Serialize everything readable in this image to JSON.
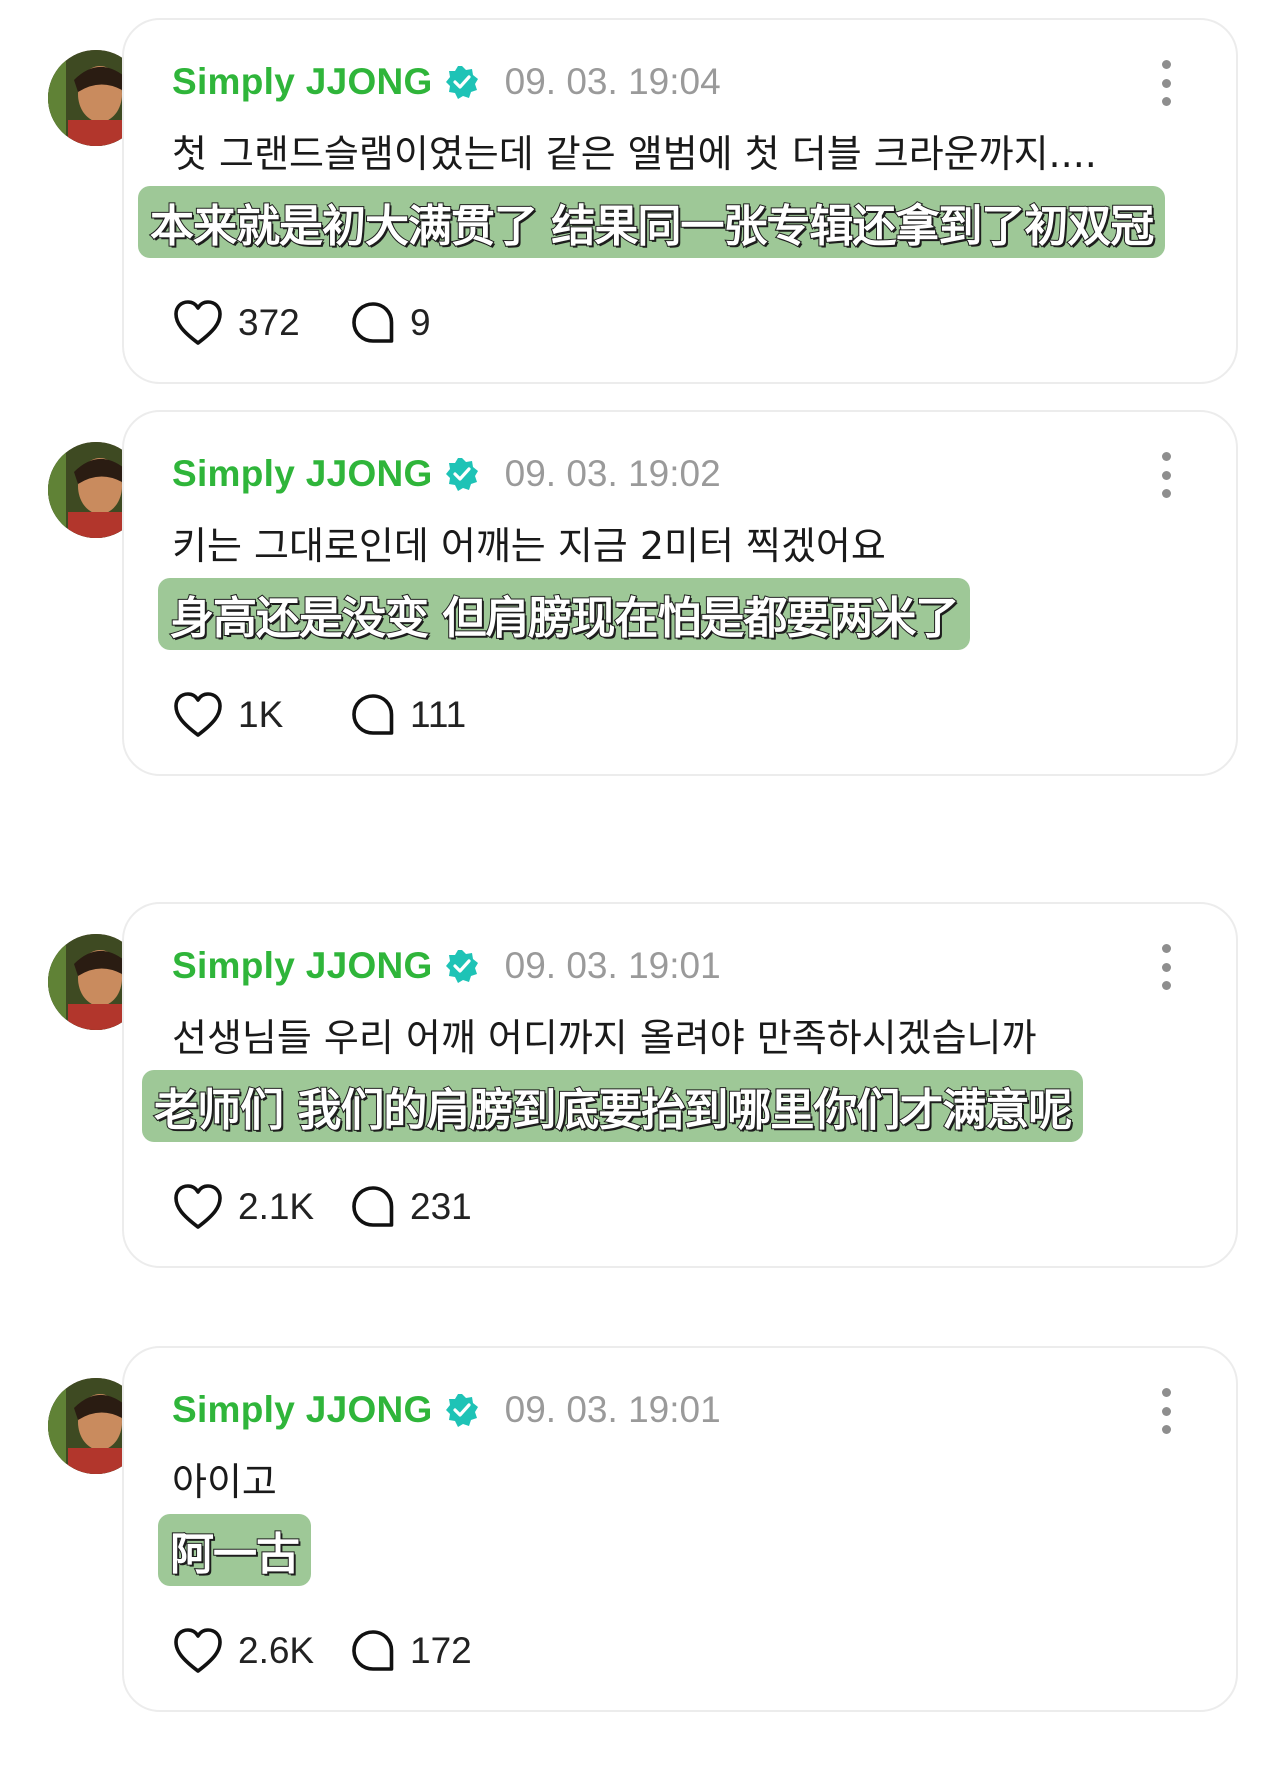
{
  "colors": {
    "username": "#2fb53a",
    "verified": "#1ec3b6",
    "timestamp": "#9a9a9a",
    "subtitle_bg": "#9ec897"
  },
  "icons": {
    "like": "heart-icon",
    "reply": "speech-bubble-icon",
    "more": "more-options-icon",
    "verified": "verified-badge-icon"
  },
  "posts": [
    {
      "username": "Simply JJONG",
      "timestamp": "09. 03. 19:04",
      "text": "첫 그랜드슬램이였는데 같은 앨범에 첫 더블 크라운까지....",
      "subtitle": "本来就是初大满贯了 结果同一张专辑还拿到了初双冠",
      "likes": "372",
      "replies": "9"
    },
    {
      "username": "Simply JJONG",
      "timestamp": "09. 03. 19:02",
      "text": "키는 그대로인데 어깨는 지금 2미터 찍겠어요",
      "subtitle": "身高还是没变 但肩膀现在怕是都要两米了",
      "likes": "1K",
      "replies": "111"
    },
    {
      "username": "Simply JJONG",
      "timestamp": "09. 03. 19:01",
      "text": "선생님들 우리 어깨 어디까지 올려야 만족하시겠습니까",
      "subtitle": "老师们 我们的肩膀到底要抬到哪里你们才满意呢",
      "likes": "2.1K",
      "replies": "231"
    },
    {
      "username": "Simply JJONG",
      "timestamp": "09. 03. 19:01",
      "text": "아이고",
      "subtitle": "阿一古",
      "likes": "2.6K",
      "replies": "172"
    }
  ]
}
